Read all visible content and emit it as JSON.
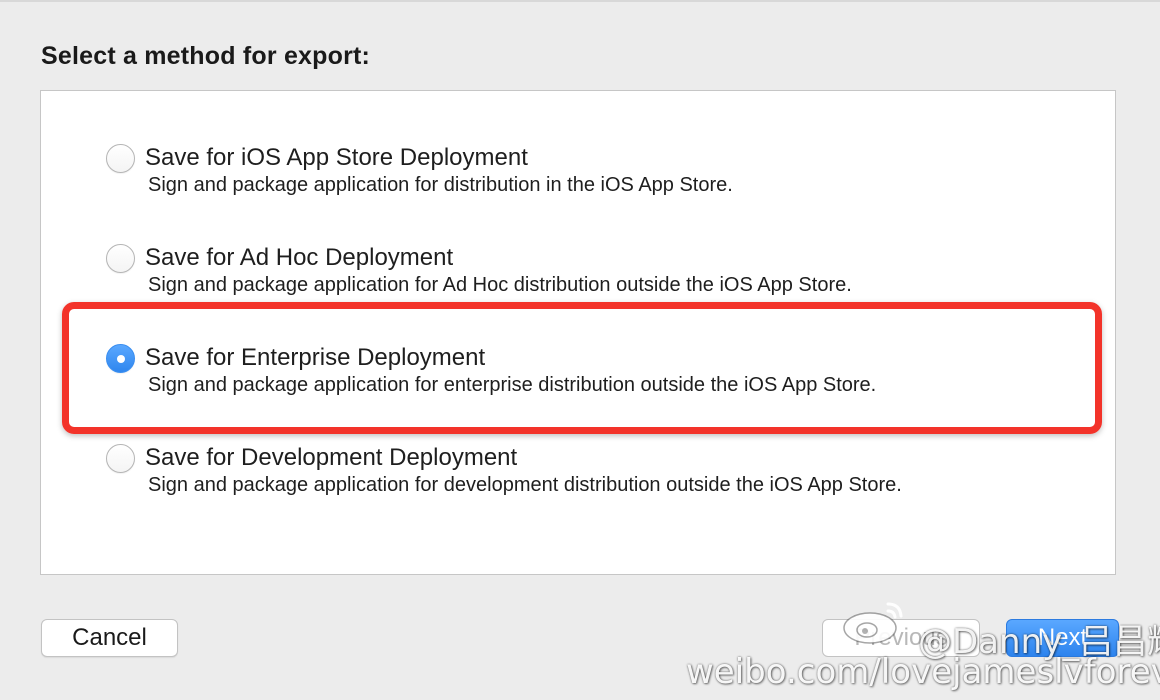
{
  "heading": "Select a method for export:",
  "options": [
    {
      "title": "Save for iOS App Store Deployment",
      "description": "Sign and package application for distribution in the iOS App Store.",
      "selected": false
    },
    {
      "title": "Save for Ad Hoc Deployment",
      "description": "Sign and package application for Ad Hoc distribution outside the iOS App Store.",
      "selected": false
    },
    {
      "title": "Save for Enterprise Deployment",
      "description": "Sign and package application for enterprise distribution outside the iOS App Store.",
      "selected": true
    },
    {
      "title": "Save for Development Deployment",
      "description": "Sign and package application for development distribution outside the iOS App Store.",
      "selected": false
    }
  ],
  "buttons": {
    "cancel": "Cancel",
    "previous": "Previous",
    "next": "Next"
  },
  "watermark": {
    "handle": "@Danny_吕昌辉",
    "url": "weibo.com/lovejameslvforever"
  },
  "colors": {
    "accent": "#3a8ef0",
    "highlight": "#f3332a",
    "background": "#ececec"
  },
  "icons": {
    "watermark_logo": "weibo-logo-icon"
  }
}
